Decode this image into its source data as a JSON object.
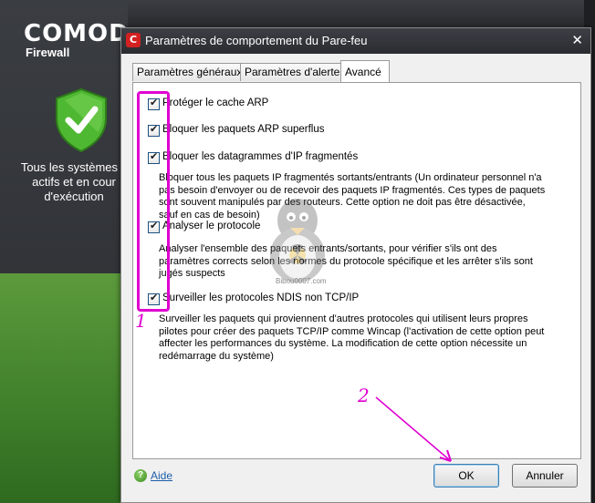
{
  "background_app": {
    "brand": "COMOD",
    "product": "Firewall",
    "status_text": "Tous les systèmes s actifs et en cour d'exécution"
  },
  "dialog": {
    "title": "Paramètres de comportement du Pare-feu",
    "close_glyph": "✕",
    "tabs": [
      {
        "label": "Paramètres généraux",
        "active": false
      },
      {
        "label": "Paramètres d'alertes",
        "active": false
      },
      {
        "label": "Avancé",
        "active": true
      }
    ],
    "options": [
      {
        "label": "Protéger le cache ARP",
        "checked": true
      },
      {
        "label": "Bloquer les paquets ARP superflus",
        "checked": true
      },
      {
        "label": "Bloquer les datagrammes d'IP fragmentés",
        "checked": true,
        "description": [
          "Bloquer tous les paquets IP fragmentés sortants/entrants (Un ordinateur personnel n'a",
          "pas besoin d'envoyer ou de recevoir des paquets IP fragmentés. Ces types de paquets",
          "sont souvent manipulés par des routeurs. Cette option ne doit pas être désactivée,",
          "sauf en cas de besoin)"
        ]
      },
      {
        "label": "Analyser le protocole",
        "checked": true,
        "description": [
          "Analyser l'ensemble des paquets entrants/sortants, pour vérifier s'ils ont des",
          "paramètres corrects selon les normes du protocole spécifique et les arrêter s'ils sont",
          "jugés suspects"
        ]
      },
      {
        "label": "Surveiller les protocoles NDIS non TCP/IP",
        "checked": true,
        "description": [
          "Surveiller les paquets qui proviennent d'autres protocoles qui utilisent leurs propres",
          "pilotes pour créer des paquets TCP/IP comme Wincap (l'activation de cette option peut",
          "affecter les performances du système. La modification de cette option nécessite un",
          "redémarrage du système)"
        ]
      }
    ],
    "help_label": "Aide",
    "ok_label": "OK",
    "cancel_label": "Annuler"
  },
  "annotations": {
    "note_1": "1",
    "note_2": "2",
    "color": "#e000d0"
  },
  "watermark": "Bibou0007.com"
}
